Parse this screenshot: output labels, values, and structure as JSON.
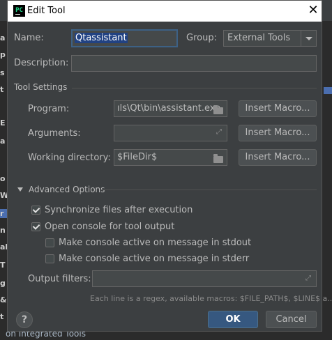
{
  "background": {
    "left_letters": [
      "a",
      "p",
      "s",
      "t",
      "E",
      "a",
      "o",
      "W",
      "r",
      "n",
      "al",
      "T",
      "g",
      "&",
      "t"
    ],
    "bottom_text": "on Integrated Tools"
  },
  "dialog": {
    "title": "Edit Tool",
    "app_icon_text": "PC",
    "close_label": "✕"
  },
  "form": {
    "name_label": "Name:",
    "name_value": "Qtassistant",
    "group_label": "Group:",
    "group_value": "External Tools",
    "description_label": "Description:",
    "description_value": ""
  },
  "tool_settings": {
    "section_label": "Tool Settings",
    "program_label": "Program:",
    "program_value": "ıls\\Qt\\bin\\assistant.exe",
    "arguments_label": "Arguments:",
    "arguments_value": "",
    "working_dir_label": "Working directory:",
    "working_dir_value": "$FileDir$",
    "insert_macro_label": "Insert Macro..."
  },
  "advanced": {
    "section_label": "Advanced Options",
    "sync_label": "Synchronize files after execution",
    "sync_checked": true,
    "console_label": "Open console for tool output",
    "console_checked": true,
    "stdout_label": "Make console active on message in stdout",
    "stdout_checked": false,
    "stderr_label": "Make console active on message in stderr",
    "stderr_checked": false,
    "output_filters_label": "Output filters:",
    "output_filters_value": "",
    "hint": "Each line is a regex, available macros: $FILE_PATH$, $LINE$ a..."
  },
  "footer": {
    "help_label": "?",
    "ok_label": "OK",
    "cancel_label": "Cancel"
  },
  "colors": {
    "dialog_bg": "#3c3f41",
    "primary_button": "#365880",
    "selection": "#214283",
    "focus_border": "#3d6185"
  }
}
